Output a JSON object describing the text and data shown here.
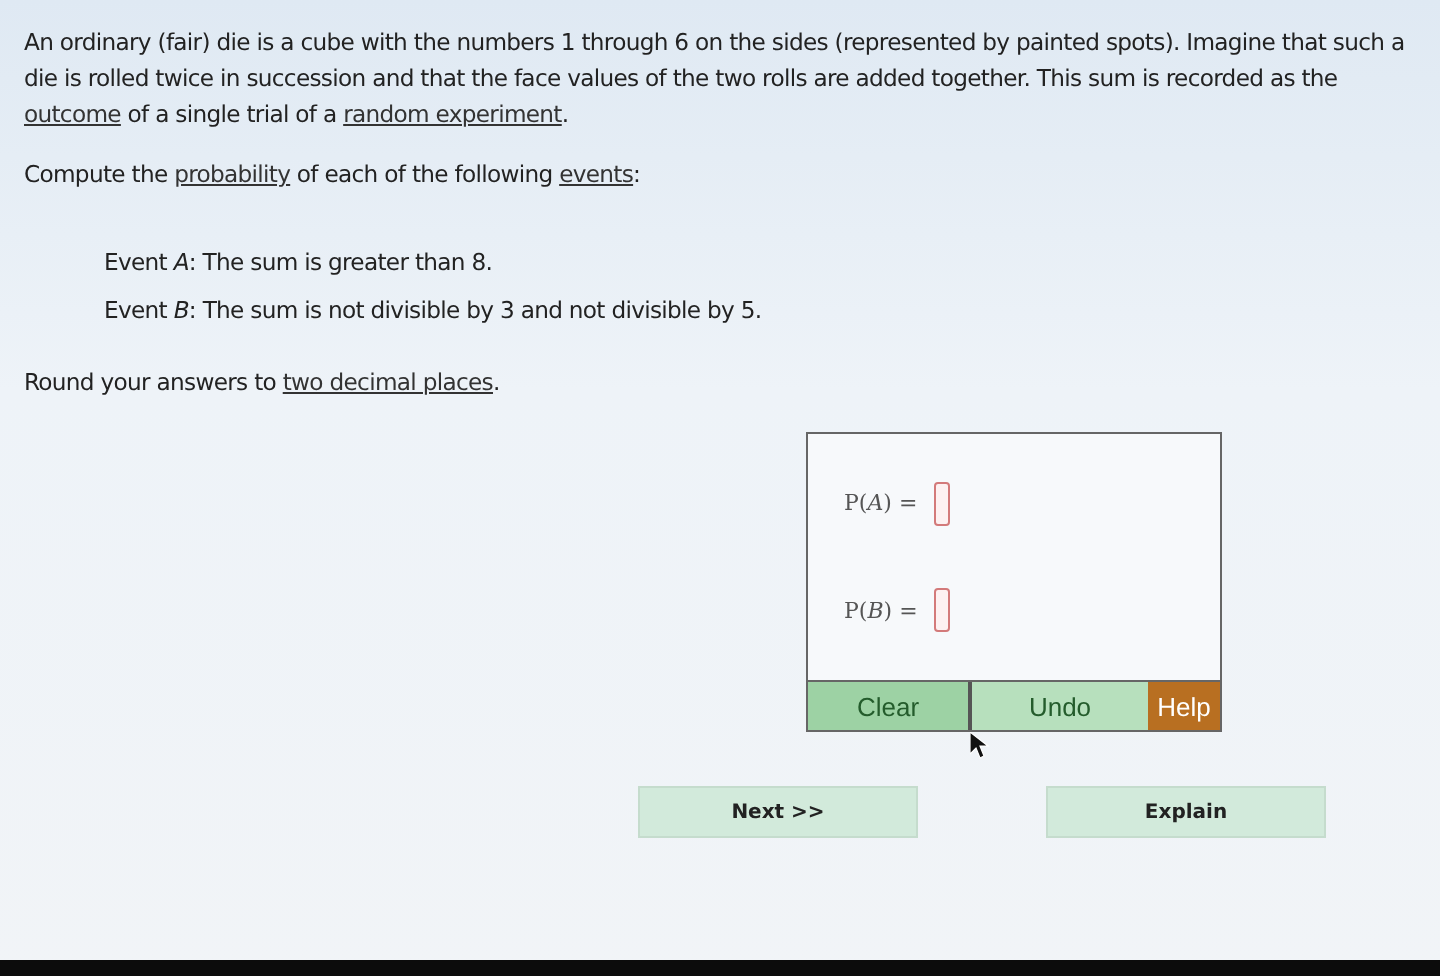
{
  "intro": [
    {
      "kind": "text",
      "text": "An ordinary (fair) die is a cube with the numbers 1 through 6 on the sides (represented by painted spots). Imagine that such a die is rolled twice in succession and that the face values of the two rolls are added together. This sum is recorded as the "
    },
    {
      "kind": "link",
      "text": "outcome"
    },
    {
      "kind": "text",
      "text": " of a single trial of a "
    },
    {
      "kind": "link",
      "text": "random experiment"
    },
    {
      "kind": "text",
      "text": "."
    }
  ],
  "prompt": [
    {
      "kind": "text",
      "text": "Compute the "
    },
    {
      "kind": "link",
      "text": "probability"
    },
    {
      "kind": "text",
      "text": " of each of the following "
    },
    {
      "kind": "link",
      "text": "events"
    },
    {
      "kind": "text",
      "text": ":"
    }
  ],
  "events": [
    "Event *A*: The sum is greater than 8.",
    "Event *B*: The sum is not divisible by 3 and not divisible by 5."
  ],
  "rounding": [
    {
      "kind": "text",
      "text": "Round your answers to "
    },
    {
      "kind": "link",
      "text": "two decimal places"
    },
    {
      "kind": "text",
      "text": "."
    }
  ],
  "answers": [
    {
      "label": "P(*A*) ="
    },
    {
      "label": "P(*B*) ="
    }
  ],
  "tool_buttons": [
    {
      "label": "Clear",
      "kind": "primary"
    },
    {
      "label": "Undo",
      "kind": "secondary"
    },
    {
      "label": "Help",
      "kind": "help"
    }
  ],
  "nav_buttons": [
    "Next >>",
    "Explain"
  ]
}
